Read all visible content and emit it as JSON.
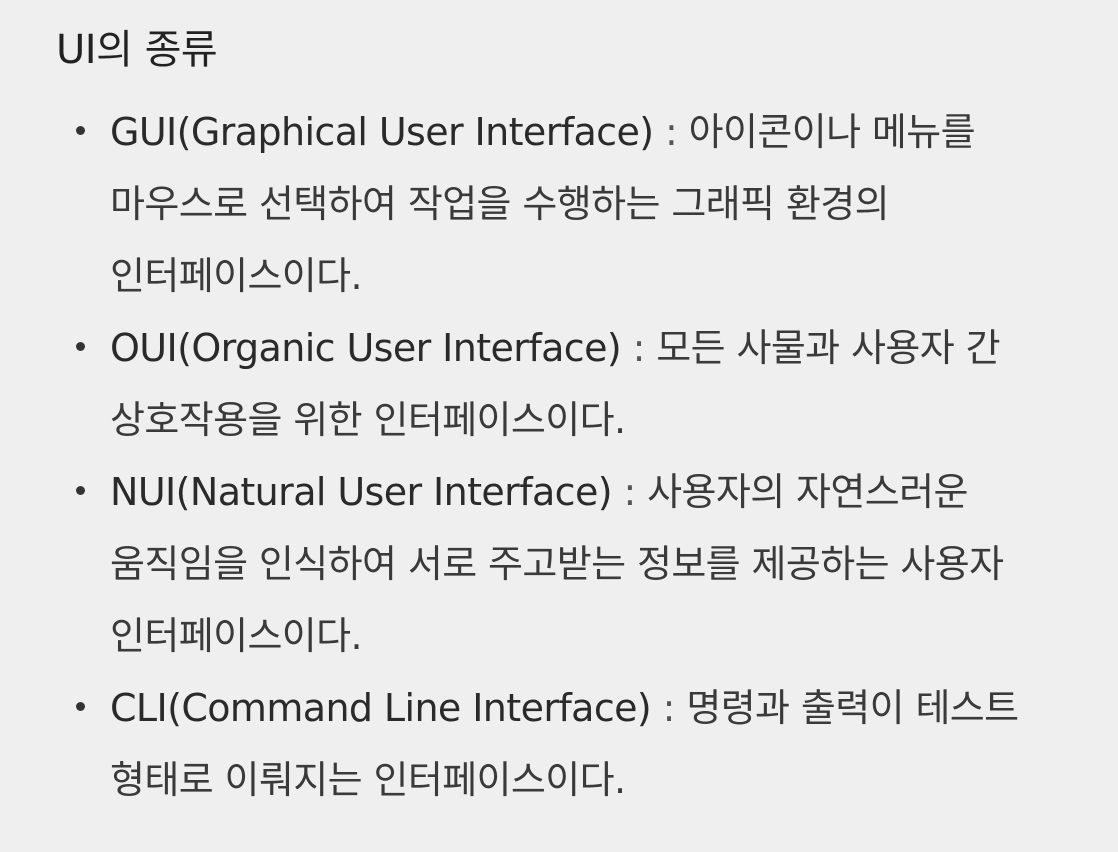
{
  "heading": "UI의 종류",
  "items": [
    {
      "term": "GUI(Graphical User Interface)",
      "separator": " : ",
      "description": "아이콘이나 메뉴를 마우스로 선택하여 작업을 수행하는 그래픽 환경의 인터페이스이다."
    },
    {
      "term": "OUI(Organic User Interface)",
      "separator": " : ",
      "description": "모든 사물과 사용자 간 상호작용을 위한 인터페이스이다."
    },
    {
      "term": "NUI(Natural User Interface)",
      "separator": " : ",
      "description": "사용자의 자연스러운 움직임을 인식하여 서로 주고받는 정보를 제공하는 사용자 인터페이스이다."
    },
    {
      "term": "CLI(Command Line Interface)",
      "separator": " : ",
      "description": "명령과 출력이 테스트 형태로 이뤄지는 인터페이스이다."
    }
  ],
  "colors": {
    "background": "#efefef",
    "text": "#222222"
  }
}
